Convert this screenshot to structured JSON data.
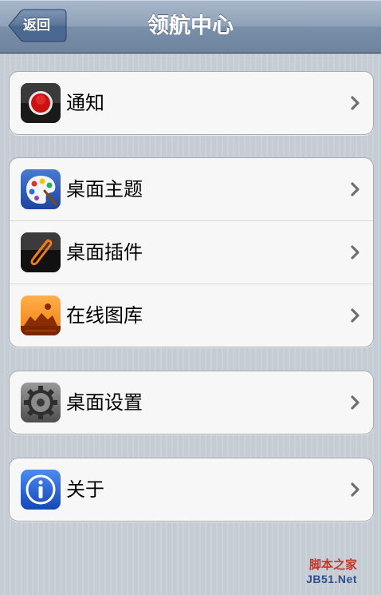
{
  "navbar": {
    "title": "领航中心",
    "back_label": "返回"
  },
  "groups": [
    {
      "items": [
        {
          "label": "通知",
          "icon": "record-icon"
        }
      ]
    },
    {
      "items": [
        {
          "label": "桌面主题",
          "icon": "palette-icon"
        },
        {
          "label": "桌面插件",
          "icon": "paperclip-icon"
        },
        {
          "label": "在线图库",
          "icon": "landscape-icon"
        }
      ]
    },
    {
      "items": [
        {
          "label": "桌面设置",
          "icon": "gear-icon"
        }
      ]
    },
    {
      "items": [
        {
          "label": "关于",
          "icon": "info-icon"
        }
      ]
    }
  ],
  "watermark": {
    "line1": "脚本之家",
    "line2": "JB51.Net"
  },
  "colors": {
    "navbar": "#8ea1b8",
    "background": "#c5ccd4",
    "group_background": "#f7f7f7"
  }
}
